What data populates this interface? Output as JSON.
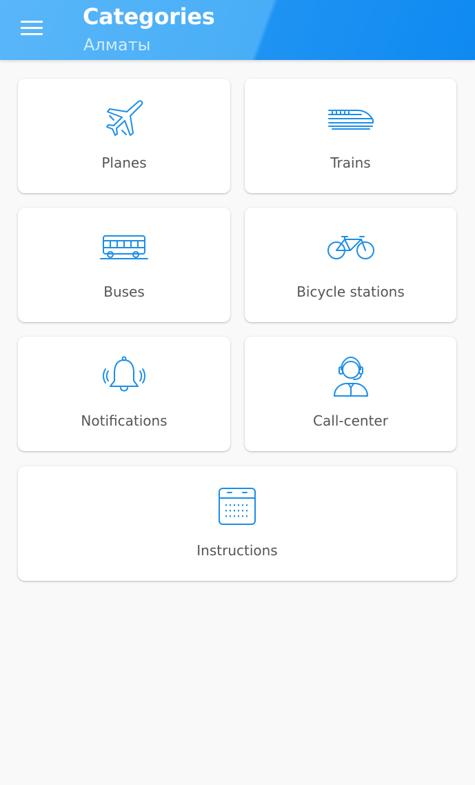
{
  "header": {
    "title": "Categories",
    "subtitle": "Алматы",
    "menu_icon": "hamburger-menu-icon"
  },
  "categories": [
    {
      "label": "Planes",
      "icon": "airplane-icon"
    },
    {
      "label": "Trains",
      "icon": "train-icon"
    },
    {
      "label": "Buses",
      "icon": "bus-icon"
    },
    {
      "label": "Bicycle stations",
      "icon": "bicycle-icon"
    },
    {
      "label": "Notifications",
      "icon": "bell-icon"
    },
    {
      "label": "Call-center",
      "icon": "headset-operator-icon"
    },
    {
      "label": "Instructions",
      "icon": "calendar-icon"
    }
  ],
  "colors": {
    "accent": "#1b8ee8",
    "appbar": "#2196f3",
    "background": "#f9f9f9"
  }
}
